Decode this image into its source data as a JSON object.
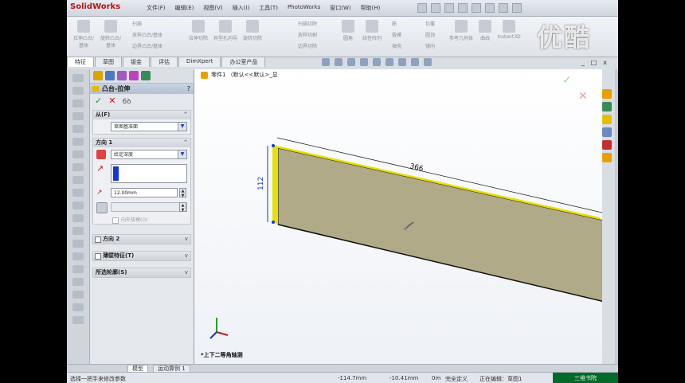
{
  "titlebar": {
    "logo": "SolidWorks",
    "menu": [
      "文件(F)",
      "编辑(E)",
      "视图(V)",
      "插入(I)",
      "工具(T)",
      "PhotoWorks",
      "窗口(W)",
      "帮助(H)"
    ]
  },
  "watermark": "优酷",
  "ribbon": {
    "buttons": [
      "拉伸凸台/基体",
      "旋转凸台/基体",
      "拉伸切除",
      "异型孔向导",
      "旋转切除",
      "圆角",
      "线性阵列",
      "筋",
      "参考几何体",
      "曲线",
      "Instant3D"
    ],
    "small": [
      "扫描",
      "放样凸台/基体",
      "边界凸台/基体",
      "扫描切除",
      "放样切割",
      "边界切除",
      "拔模",
      "抽壳",
      "包覆",
      "圆顶",
      "镜向"
    ]
  },
  "tabs": [
    "特征",
    "草图",
    "钣金",
    "评估",
    "DimXpert",
    "办公室产品"
  ],
  "window_buttons": [
    "_",
    "□",
    "x"
  ],
  "property_manager": {
    "title": "凸台-拉伸",
    "help": "?",
    "from_section": {
      "title": "从(F)",
      "chev": "^",
      "value": "草图基准面"
    },
    "direction1_section": {
      "title": "方向 1",
      "chev": "^",
      "end_condition": "给定深度",
      "depth": "12.00mm",
      "outward_draft": "向外拔模(O)"
    },
    "collapsed": [
      {
        "label": "方向 2",
        "chev": "v"
      },
      {
        "label": "薄壁特征(T)",
        "chev": "v"
      },
      {
        "label": "所选轮廓(S)",
        "chev": "v"
      }
    ]
  },
  "viewport": {
    "tree_label": "零件1 （默认<<默认>_显",
    "dim_width": "366",
    "dim_height": "112",
    "view_name": "*上下二等角轴测",
    "confirm_ok": "✓",
    "confirm_cancel": "✕"
  },
  "bottom_tabs": [
    "模型",
    "运动算例 1"
  ],
  "status": {
    "message": "选择一把手来修改参数",
    "x": "-114.7mm",
    "y": "-10.41mm",
    "z": "0m",
    "defined": "完全定义",
    "editing": "正在编辑：草图1"
  },
  "corner_label": "三维书院",
  "colors": {
    "face": "#b0aa88",
    "edge_highlight": "#e8e000",
    "accent_blue": "#1436d6",
    "ok_green": "#2a9a2a",
    "cancel_red": "#c01e1e"
  }
}
